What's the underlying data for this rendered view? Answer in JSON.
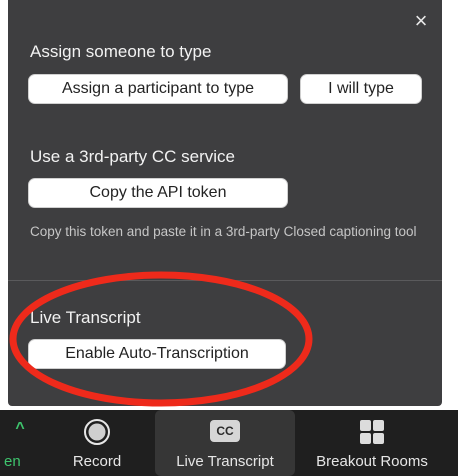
{
  "panel": {
    "close_symbol": "×",
    "assign_section": {
      "title": "Assign someone to type",
      "assign_button": "Assign a participant to type",
      "self_button": "I will type"
    },
    "third_party_section": {
      "title": "Use a 3rd-party CC service",
      "copy_button": "Copy the API token",
      "description": "Copy this token and paste it in a 3rd-party Closed captioning tool"
    },
    "live_transcript_section": {
      "title": "Live Transcript",
      "enable_button": "Enable Auto-Transcription"
    }
  },
  "toolbar": {
    "partial_label": "en",
    "chevron": "^",
    "items": [
      {
        "label": "Record",
        "icon": "record-icon"
      },
      {
        "label": "Live Transcript",
        "icon": "cc-icon",
        "icon_text": "CC"
      },
      {
        "label": "Breakout Rooms",
        "icon": "breakout-rooms-icon"
      }
    ]
  },
  "colors": {
    "panel_bg": "#3e3e40",
    "toolbar_bg": "#1f1f1f",
    "highlight_ellipse": "#ee2a1b",
    "chevron_green": "#3ec46d"
  }
}
